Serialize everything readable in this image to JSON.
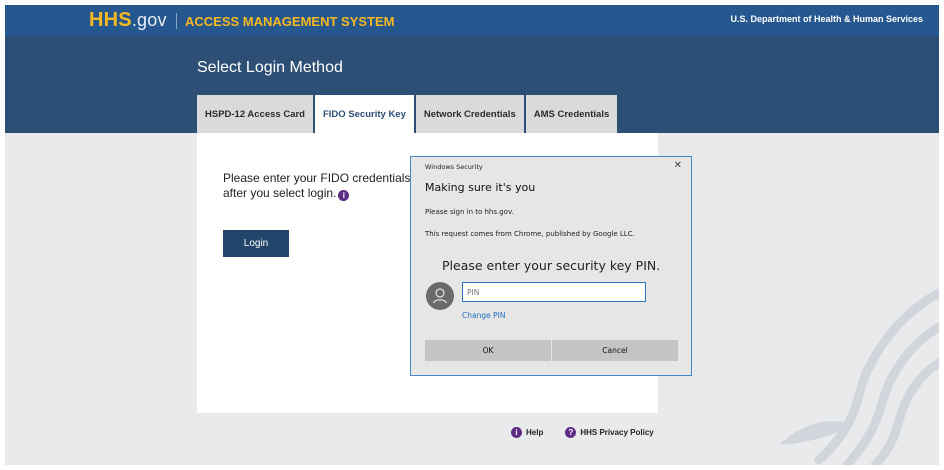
{
  "header": {
    "logo_hhs": "HHS",
    "logo_gov": ".gov",
    "system_title": "ACCESS MANAGEMENT SYSTEM",
    "department": "U.S. Department of Health & Human Services"
  },
  "login": {
    "heading": "Select Login Method",
    "tabs": [
      {
        "label": "HSPD-12 Access Card",
        "active": false
      },
      {
        "label": "FIDO Security Key",
        "active": true
      },
      {
        "label": "Network Credentials",
        "active": false
      },
      {
        "label": "AMS Credentials",
        "active": false
      }
    ],
    "instruction_line1": "Please enter your FIDO credentials",
    "instruction_line2": "after you select login.",
    "login_button": "Login"
  },
  "footer": {
    "help": "Help",
    "privacy": "HHS Privacy Policy"
  },
  "dialog": {
    "app_name": "Windows Security",
    "close_glyph": "✕",
    "title": "Making sure it's you",
    "line1": "Please sign in to hhs.gov.",
    "line2": "This request comes from Chrome, published by Google LLC.",
    "prompt": "Please enter your security key PIN.",
    "pin_placeholder": "PIN",
    "pin_value": "",
    "change_pin": "Change PIN",
    "ok_button": "OK",
    "cancel_button": "Cancel"
  },
  "colors": {
    "topbar": "#26588f",
    "hero": "#2d4f75",
    "brand_gold": "#f5b921",
    "login_button": "#23446b",
    "info_icon": "#5e2c83",
    "dialog_border": "#4a87c8",
    "link_blue": "#1e6fc1"
  }
}
